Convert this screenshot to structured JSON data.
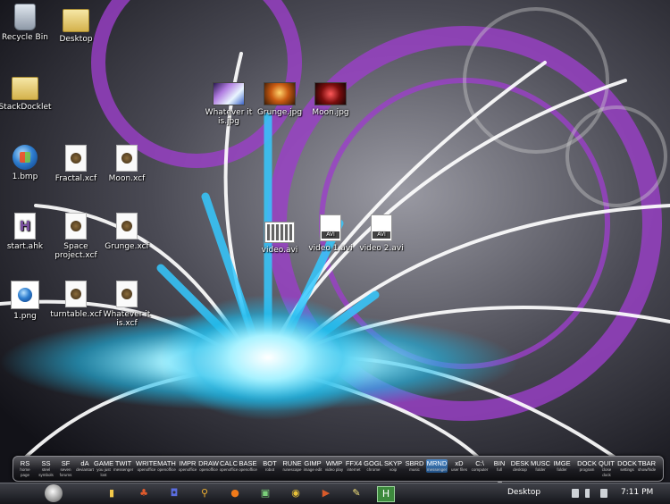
{
  "desktop_icons": [
    {
      "label": "Recycle Bin",
      "icon": "recycle-bin-icon"
    },
    {
      "label": "Desktop",
      "icon": "folder-icon"
    },
    {
      "label": "StackDocklet",
      "icon": "folder-icon"
    },
    {
      "label": "1.bmp",
      "icon": "image-file-icon"
    },
    {
      "label": "Fractal.xcf",
      "icon": "gimp-file-icon"
    },
    {
      "label": "Moon.xcf",
      "icon": "gimp-file-icon"
    },
    {
      "label": "start.ahk",
      "icon": "autohotkey-file-icon"
    },
    {
      "label": "Space project.xcf",
      "icon": "gimp-file-icon"
    },
    {
      "label": "Grunge.xcf",
      "icon": "gimp-file-icon"
    },
    {
      "label": "1.png",
      "icon": "image-file-icon"
    },
    {
      "label": "turntable.xcf",
      "icon": "gimp-file-icon"
    },
    {
      "label": "Whatever it is.xcf",
      "icon": "gimp-file-icon"
    },
    {
      "label": "Whatever it is.jpg",
      "icon": "image-thumbnail-icon"
    },
    {
      "label": "Grunge.jpg",
      "icon": "image-thumbnail-icon"
    },
    {
      "label": "Moon.jpg",
      "icon": "image-thumbnail-icon"
    },
    {
      "label": "video.avi",
      "icon": "video-file-icon"
    },
    {
      "label": "video 1.avi",
      "icon": "video-file-icon"
    },
    {
      "label": "video 2.avi",
      "icon": "video-file-icon"
    }
  ],
  "dock": {
    "items": [
      {
        "label": "RS",
        "sub": "home page"
      },
      {
        "label": "SS",
        "sub": "steel symbols"
      },
      {
        "label": "SF",
        "sub": "seven forums"
      },
      {
        "label": "dA",
        "sub": "deviantart"
      },
      {
        "label": "GAME",
        "sub": "you just lost"
      },
      {
        "label": "TWIT",
        "sub": "messenger"
      },
      {
        "label": "WRITE",
        "sub": "openoffice"
      },
      {
        "label": "MATH",
        "sub": "openoffice"
      },
      {
        "label": "IMPR",
        "sub": "openoffice"
      },
      {
        "label": "DRAW",
        "sub": "openoffice"
      },
      {
        "label": "CALC",
        "sub": "openoffice"
      },
      {
        "label": "BASE",
        "sub": "openoffice"
      },
      {
        "label": "BOT",
        "sub": "robot"
      },
      {
        "label": "RUNE",
        "sub": "runescape"
      },
      {
        "label": "GIMP",
        "sub": "image edit"
      },
      {
        "label": "WMP",
        "sub": "video play"
      },
      {
        "label": "FFX4",
        "sub": "internet"
      },
      {
        "label": "GOGL",
        "sub": "chrome"
      },
      {
        "label": "SKYP",
        "sub": "voip"
      },
      {
        "label": "SBRD",
        "sub": "music"
      },
      {
        "label": "MRND",
        "sub": "messenger"
      },
      {
        "label": "xD",
        "sub": "user files"
      },
      {
        "label": "C:\\",
        "sub": "computer"
      },
      {
        "label": "BIN",
        "sub": "full"
      },
      {
        "label": "DESK",
        "sub": "desktop"
      },
      {
        "label": "MUSC",
        "sub": "folder"
      },
      {
        "label": "IMGE",
        "sub": "folder"
      },
      {
        "label": "DOCK",
        "sub": "program"
      },
      {
        "label": "QUIT",
        "sub": "close dock"
      },
      {
        "label": "DOCK",
        "sub": "settings"
      },
      {
        "label": "TBAR",
        "sub": "show/hide"
      }
    ]
  },
  "taskbar": {
    "desktop_label": "Desktop",
    "clock": "7:11 PM"
  },
  "colors": {
    "accent": "#3fd2ff",
    "purple": "#8b2fb8"
  }
}
